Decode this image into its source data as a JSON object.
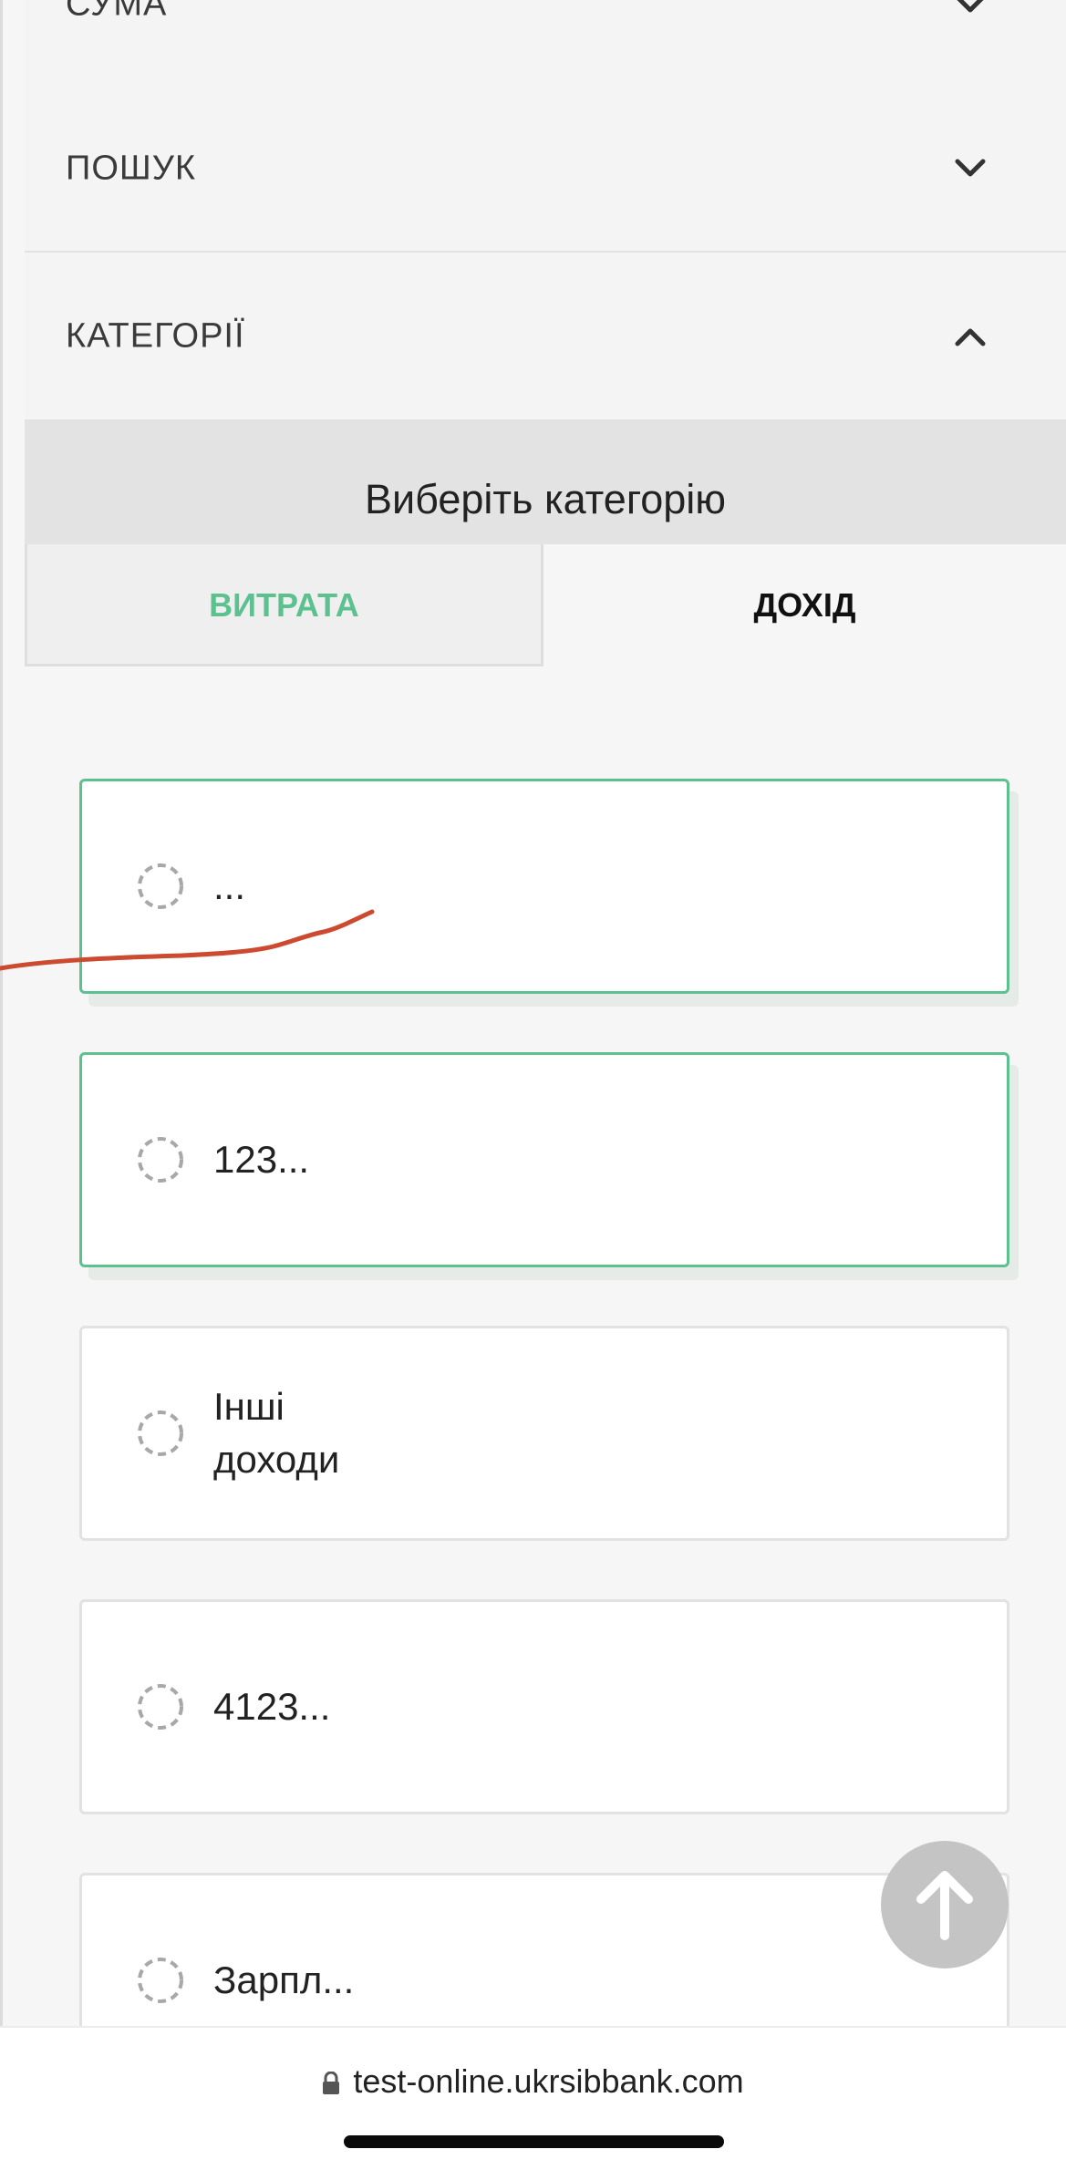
{
  "accordion": {
    "amount_label": "СУМА",
    "search_label": "ПОШУК",
    "categories_label": "КАТЕГОРІЇ"
  },
  "category_picker": {
    "title": "Виберіть категорію",
    "tabs": {
      "expense_label": "ВИТРАТА",
      "income_label": "ДОХІД"
    },
    "items": [
      {
        "label": "...",
        "selected": true
      },
      {
        "label": "123...",
        "selected": true
      },
      {
        "label": "Інші\nдоходи",
        "selected": false
      },
      {
        "label": "4123...",
        "selected": false
      },
      {
        "label": "Зарпл...",
        "selected": false
      }
    ]
  },
  "browser": {
    "url": "test-online.ukrsibbank.com"
  },
  "colors": {
    "accent_green": "#5cc08f",
    "scribble_red": "#cc4a30"
  }
}
